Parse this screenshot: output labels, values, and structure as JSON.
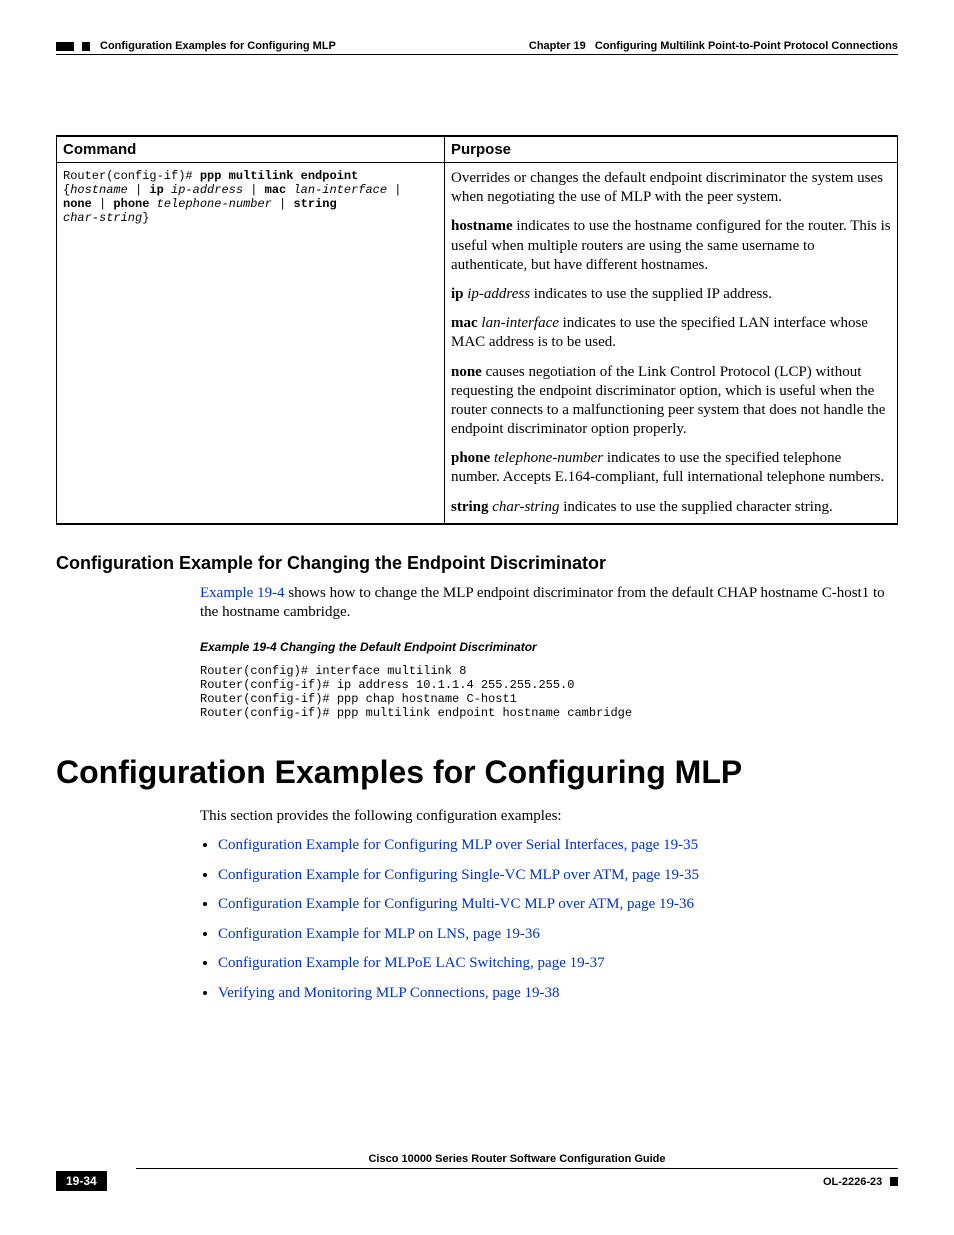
{
  "header": {
    "chapterLabel": "Chapter 19",
    "chapterTitle": "Configuring Multilink Point-to-Point Protocol Connections",
    "sectionTitle": "Configuration Examples for Configuring MLP"
  },
  "table": {
    "headers": {
      "command": "Command",
      "purpose": "Purpose"
    },
    "command": {
      "prompt": "Router(config-if)# ",
      "cmd": "ppp multilink endpoint",
      "line2_open": "{",
      "line2_hostname": "hostname",
      "line2_sep1": " | ",
      "line2_ip": "ip",
      "line2_ipaddr": " ip-address",
      "line2_sep2": " | ",
      "line2_mac": "mac",
      "line2_lan": " lan-interface",
      "line2_sep3": " |",
      "line3_none": "none",
      "line3_sep1": " | ",
      "line3_phone": "phone",
      "line3_tel": " telephone-number",
      "line3_sep2": " | ",
      "line3_string": "string",
      "line4_char": "char-string",
      "line4_close": "}"
    },
    "purpose": {
      "p1": "Overrides or changes the default endpoint discriminator the system uses when negotiating the use of MLP with the peer system.",
      "p2_b": "hostname",
      "p2_rest": " indicates to use the hostname configured for the router. This is useful when multiple routers are using the same username to authenticate, but have different hostnames.",
      "p3_b": "ip",
      "p3_i": " ip-address",
      "p3_rest": " indicates to use the supplied IP address.",
      "p4_b": "mac",
      "p4_i": " lan-interface",
      "p4_rest": " indicates to use the specified LAN interface whose MAC address is to be used.",
      "p5_b": "none",
      "p5_rest": " causes negotiation of the Link Control Protocol (LCP) without requesting the endpoint discriminator option, which is useful when the router connects to a malfunctioning peer system that does not handle the endpoint discriminator option properly.",
      "p6_b": "phone",
      "p6_i": " telephone-number",
      "p6_rest": " indicates to use the specified telephone number. Accepts E.164-compliant, full international telephone numbers.",
      "p7_b": "string",
      "p7_i": " char-string",
      "p7_rest": " indicates to use the supplied character string."
    }
  },
  "subsection": {
    "title": "Configuration Example for Changing the Endpoint Discriminator",
    "para_link": "Example 19-4",
    "para_rest": " shows how to change the MLP endpoint discriminator from the default CHAP hostname C-host1 to the hostname cambridge.",
    "exampleCaption": "Example 19-4   Changing the Default Endpoint Discriminator",
    "code": "Router(config)# interface multilink 8\nRouter(config-if)# ip address 10.1.1.4 255.255.255.0\nRouter(config-if)# ppp chap hostname C-host1\nRouter(config-if)# ppp multilink endpoint hostname cambridge"
  },
  "mainSection": {
    "title": "Configuration Examples for Configuring MLP",
    "intro": "This section provides the following configuration examples:",
    "links": [
      "Configuration Example for Configuring MLP over Serial Interfaces, page 19-35",
      "Configuration Example for Configuring Single-VC MLP over ATM, page 19-35",
      "Configuration Example for Configuring Multi-VC MLP over ATM, page 19-36",
      "Configuration Example for MLP on LNS, page 19-36",
      "Configuration Example for MLPoE LAC Switching, page 19-37",
      "Verifying and Monitoring MLP Connections, page 19-38"
    ]
  },
  "footer": {
    "guide": "Cisco 10000 Series Router Software Configuration Guide",
    "pageNum": "19-34",
    "docNum": "OL-2226-23"
  }
}
